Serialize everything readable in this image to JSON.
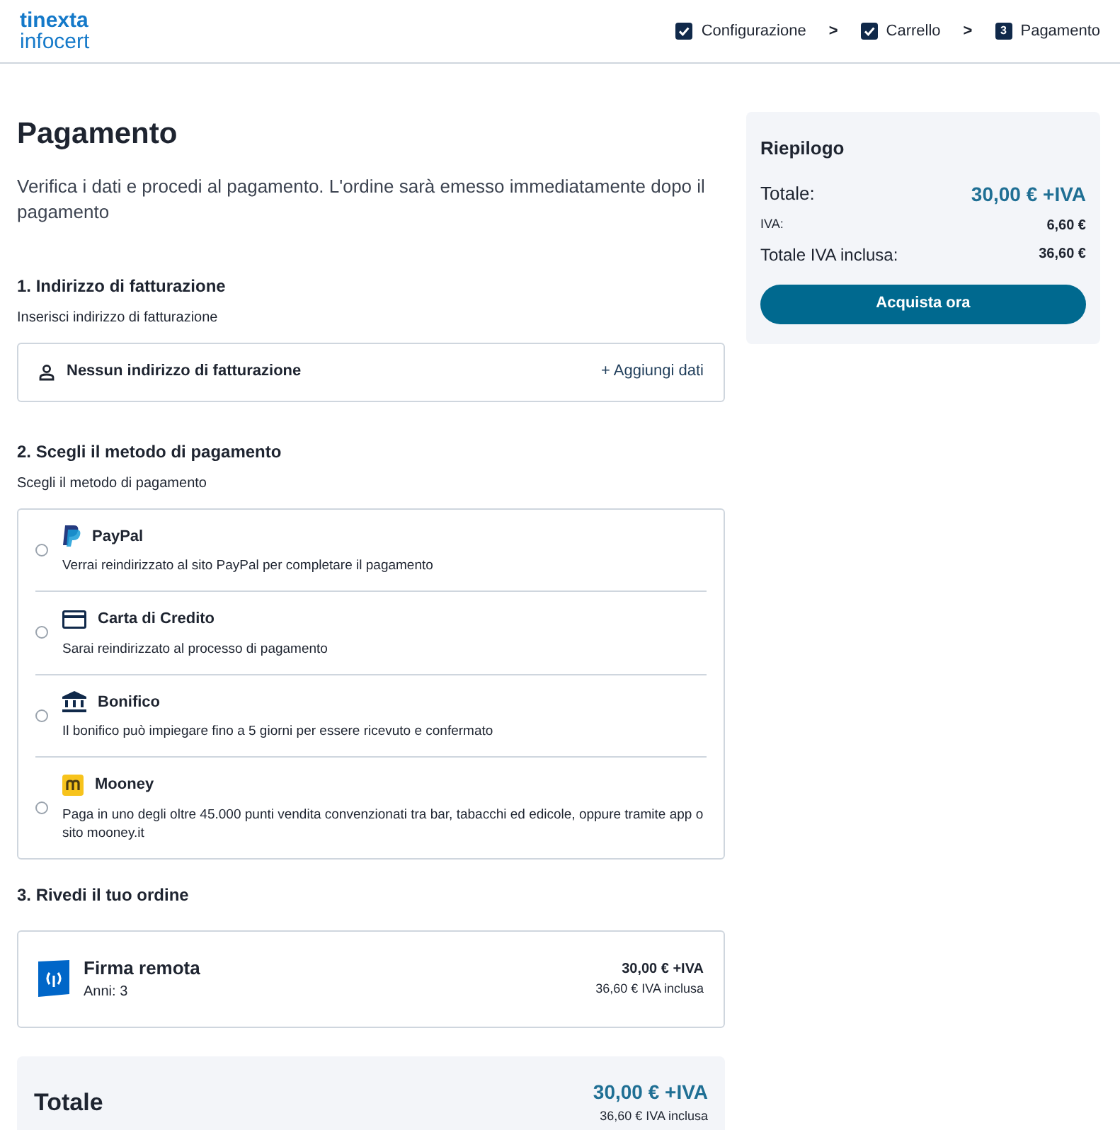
{
  "logo": {
    "line_1": "tinexta",
    "line_2": "infocert"
  },
  "steps": [
    {
      "label": "Configurazione",
      "kind": "done"
    },
    {
      "separator": ">",
      "label": "Carrello",
      "kind": "done"
    },
    {
      "separator": ">",
      "label": "Pagamento",
      "kind": "current",
      "number": "3"
    }
  ],
  "title": "Pagamento",
  "intro": "Verifica i dati e procedi al pagamento. L'ordine sarà emesso immediatamente dopo il pagamento",
  "billing": {
    "heading": "1. Indirizzo di fatturazione",
    "subheading": "Inserisci indirizzo di fatturazione",
    "empty_text": "Nessun indirizzo di fatturazione",
    "add_button": "+ Aggiungi dati"
  },
  "payment": {
    "heading": "2. Scegli il metodo di pagamento",
    "subheading": "Scegli il metodo di pagamento",
    "methods": [
      {
        "kind": "paypal",
        "name": "PayPal",
        "description": "Verrai reindirizzato al sito PayPal per completare il pagamento",
        "selected": false
      },
      {
        "kind": "card",
        "name": "Carta di Credito",
        "description": "Sarai reindirizzato al processo di pagamento",
        "selected": false
      },
      {
        "kind": "bank",
        "name": "Bonifico",
        "description": "Il bonifico può impiegare fino a 5 giorni per essere ricevuto e confermato",
        "selected": false
      },
      {
        "kind": "mooney",
        "name": "Mooney",
        "description": "Paga in uno degli oltre 45.000 punti vendita convenzionati tra bar, tabacchi ed edicole, oppure tramite app o sito mooney.it",
        "selected": false
      }
    ]
  },
  "order": {
    "heading": "3. Rivedi il tuo ordine",
    "items": [
      {
        "name": "Firma remota",
        "detail": "Anni: 3",
        "price": "30,00 € +IVA",
        "price_incl": "36,60 € IVA inclusa"
      }
    ]
  },
  "total": {
    "label": "Totale",
    "price": "30,00 € +IVA",
    "price_incl": "36,60 € IVA inclusa"
  },
  "summary": {
    "title": "Riepilogo",
    "rows": [
      {
        "kind": "main",
        "label": "Totale:",
        "value": "30,00 € +IVA"
      },
      {
        "kind": "small",
        "label": "IVA:",
        "value": "6,60 €"
      },
      {
        "kind": "incl",
        "label": "Totale IVA inclusa:",
        "value": "36,60 €"
      }
    ],
    "button": "Acquista ora"
  }
}
